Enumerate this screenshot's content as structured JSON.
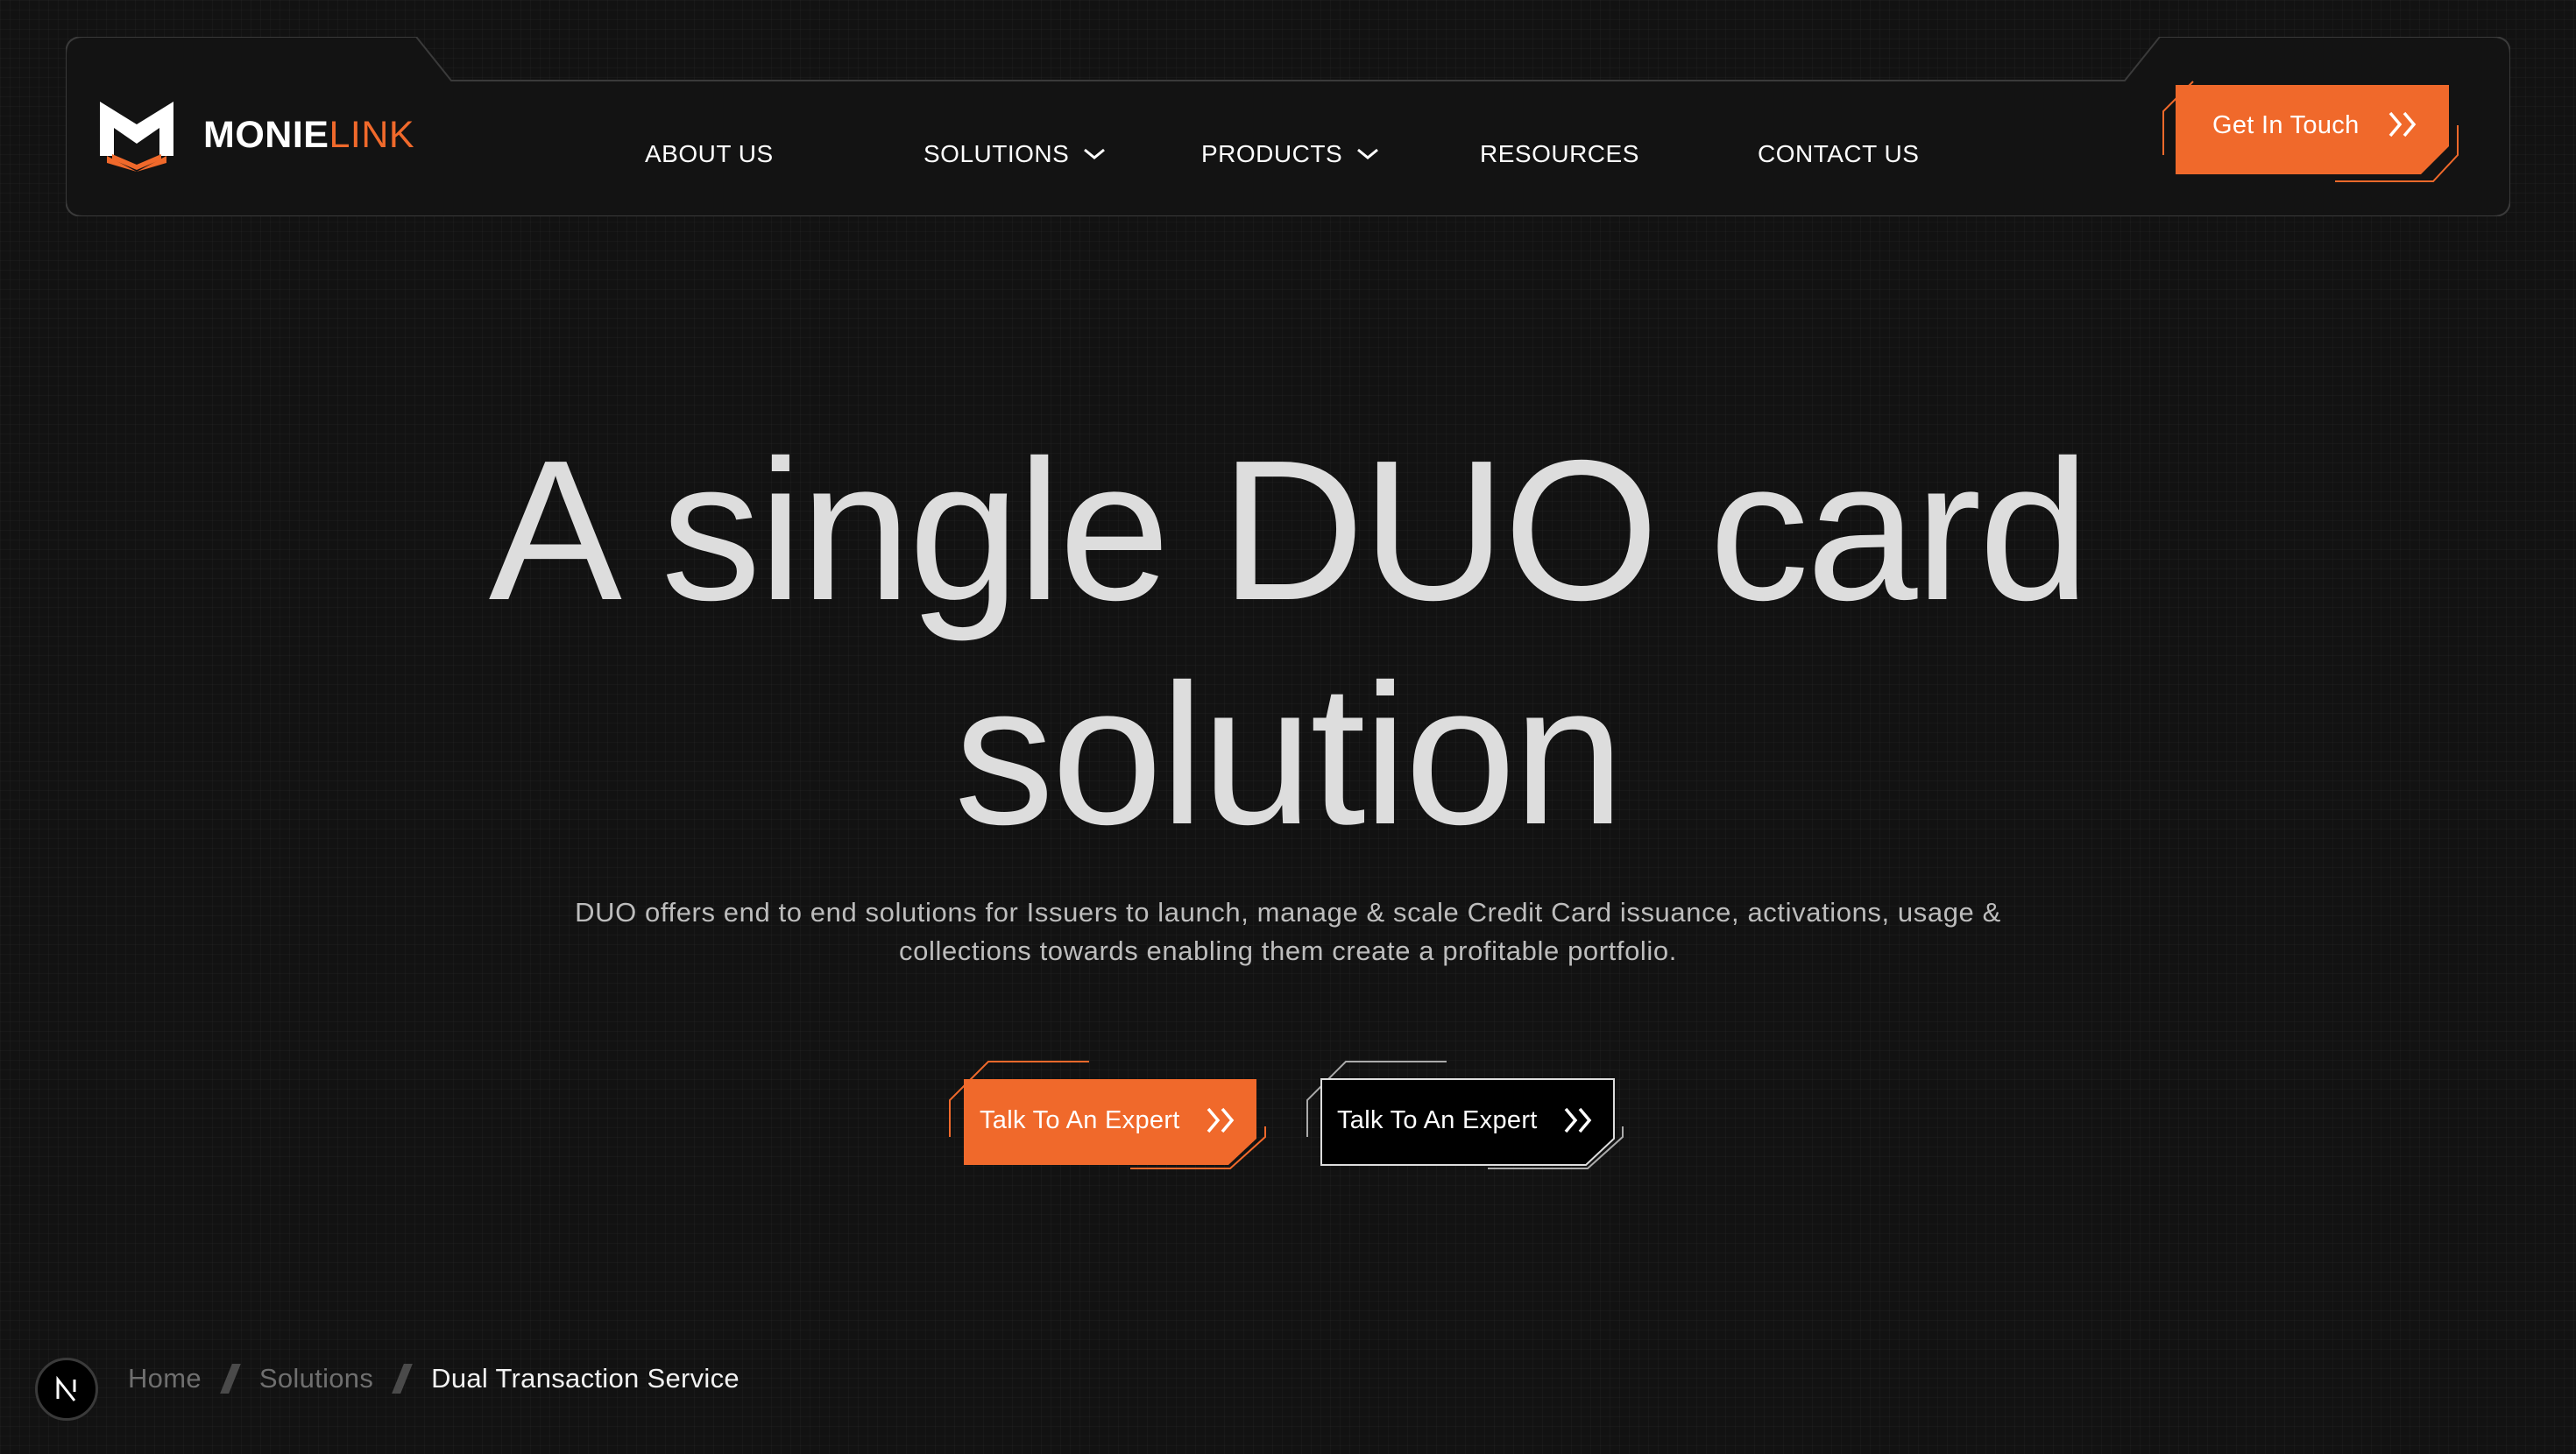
{
  "brand": {
    "name_primary": "MONIE",
    "name_accent": "LINK",
    "logo_icon": "monielink-m-logo-icon"
  },
  "nav": {
    "items": [
      {
        "label": "ABOUT US",
        "has_dropdown": false
      },
      {
        "label": "SOLUTIONS",
        "has_dropdown": true
      },
      {
        "label": "PRODUCTS",
        "has_dropdown": true
      },
      {
        "label": "RESOURCES",
        "has_dropdown": false
      },
      {
        "label": "CONTACT US",
        "has_dropdown": false
      }
    ],
    "cta_label": "Get In Touch",
    "cta_icon": "double-chevron-right-icon"
  },
  "hero": {
    "title_line1": "A single DUO card",
    "title_line2": "solution",
    "subtitle_line1": "DUO offers end to end solutions for Issuers to launch, manage & scale Credit Card issuance, activations, usage &",
    "subtitle_line2": "collections towards enabling them create a profitable portfolio.",
    "primary_button": "Talk To An Expert",
    "secondary_button": "Talk To An Expert"
  },
  "breadcrumb": {
    "items": [
      "Home",
      "Solutions"
    ],
    "current": "Dual Transaction Service"
  },
  "badge": {
    "letter": "N",
    "icon": "nextjs-indicator-icon"
  },
  "colors": {
    "accent": "#f0692b",
    "background": "#121212",
    "text": "#dddddd",
    "muted": "#6f6f6f"
  }
}
